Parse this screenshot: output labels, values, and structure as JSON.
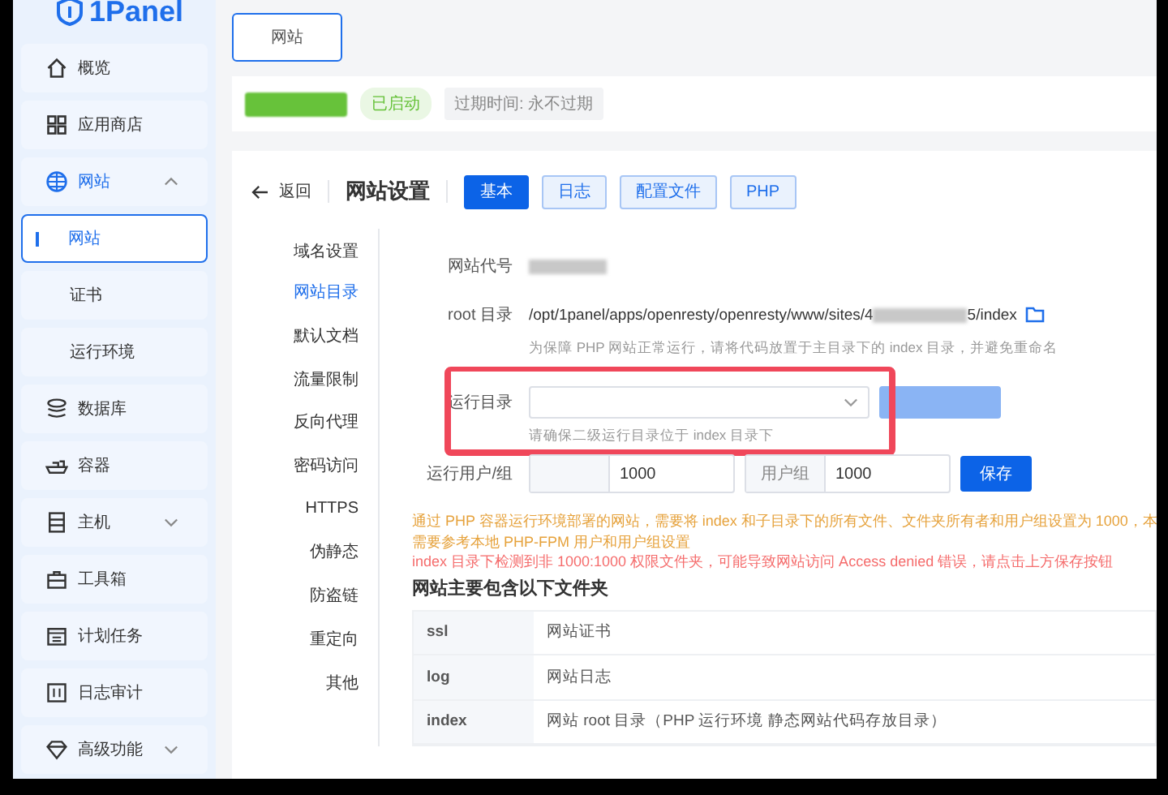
{
  "sidebar": {
    "logo": "1Panel",
    "items": [
      {
        "label": "概览",
        "selected": false
      },
      {
        "label": "应用商店",
        "selected": false
      },
      {
        "label": "网站",
        "selected": false,
        "expanded": true,
        "children": [
          {
            "label": "网站",
            "selected": true
          },
          {
            "label": "证书",
            "selected": false
          },
          {
            "label": "运行环境",
            "selected": false
          }
        ]
      },
      {
        "label": "数据库",
        "selected": false
      },
      {
        "label": "容器",
        "selected": false
      },
      {
        "label": "主机",
        "selected": false,
        "expanded": false
      },
      {
        "label": "工具箱",
        "selected": false
      },
      {
        "label": "计划任务",
        "selected": false
      },
      {
        "label": "日志审计",
        "selected": false
      },
      {
        "label": "高级功能",
        "selected": false,
        "expanded": false
      }
    ]
  },
  "top_tab": {
    "label": "网站",
    "selected": true
  },
  "site_bar": {
    "status": "已启动",
    "expiry": "过期时间: 永不过期"
  },
  "settings": {
    "back": "返回",
    "title": "网站设置",
    "tabs": [
      {
        "label": "基本",
        "selected": true
      },
      {
        "label": "日志",
        "selected": false
      },
      {
        "label": "配置文件",
        "selected": false
      },
      {
        "label": "PHP",
        "selected": false
      }
    ],
    "nav": [
      {
        "label": "域名设置",
        "selected": false
      },
      {
        "label": "网站目录",
        "selected": true
      },
      {
        "label": "默认文档",
        "selected": false
      },
      {
        "label": "流量限制",
        "selected": false
      },
      {
        "label": "反向代理",
        "selected": false
      },
      {
        "label": "密码访问",
        "selected": false
      },
      {
        "label": "HTTPS",
        "selected": false
      },
      {
        "label": "伪静态",
        "selected": false
      },
      {
        "label": "防盗链",
        "selected": false
      },
      {
        "label": "重定向",
        "selected": false
      },
      {
        "label": "其他",
        "selected": false
      }
    ],
    "site_code_label": "网站代号",
    "root_label": "root 目录",
    "root_path_start": "/opt/1panel/apps/openresty/openresty/www/sites/4",
    "root_path_end": "5/index",
    "root_hint": "为保障 PHP 网站正常运行，请将代码放置于主目录下的 index 目录，并避免重命名",
    "run_dir_label": "运行目录",
    "run_dir_hint": "请确保二级运行目录位于 index 目录下",
    "user_label": "运行用户/组",
    "user_value": "1000",
    "group_label": "用户组",
    "group_value": "1000",
    "save": "保存",
    "notes": [
      {
        "kind": "warn",
        "text": "通过 PHP 容器运行环境部署的网站，需要将 index 和子目录下的所有文件、文件夹所有者和用户组设置为 1000，本"
      },
      {
        "kind": "warn",
        "text": "需要参考本地 PHP-FPM 用户和用户组设置"
      },
      {
        "kind": "error",
        "text": "index 目录下检测到非 1000:1000 权限文件夹，可能导致网站访问 Access denied 错误，请点击上方保存按钮"
      }
    ],
    "folders_title": "网站主要包含以下文件夹",
    "folders": [
      {
        "name": "ssl",
        "desc": "网站证书"
      },
      {
        "name": "log",
        "desc": "网站日志"
      },
      {
        "name": "index",
        "desc": "网站 root 目录（PHP 运行环境 静态网站代码存放目录）"
      }
    ]
  }
}
